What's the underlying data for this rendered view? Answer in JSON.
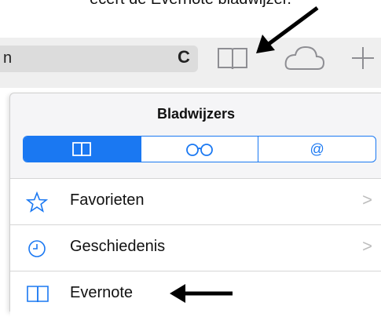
{
  "caption": "ecert de Evernote bladwijzer.",
  "toolbar": {
    "url_text": "n",
    "reload_glyph": "C",
    "icons": [
      "bookmarks-icon",
      "cloud-icon",
      "plus-icon"
    ]
  },
  "popover": {
    "title": "Bladwijzers",
    "tabs": [
      {
        "icon": "book-icon",
        "selected": true
      },
      {
        "icon": "reading-list-icon",
        "selected": false
      },
      {
        "label": "@",
        "icon": "at-icon",
        "selected": false
      }
    ],
    "items": [
      {
        "label": "Favorieten",
        "icon": "star-icon",
        "chevron": ">"
      },
      {
        "label": "Geschiedenis",
        "icon": "clock-icon",
        "chevron": ">"
      },
      {
        "label": "Evernote",
        "icon": "book-icon",
        "chevron": ""
      }
    ]
  },
  "colors": {
    "accent": "#1a78f2",
    "toolbar": "#efefef",
    "urlbar": "#dcdcdc"
  }
}
